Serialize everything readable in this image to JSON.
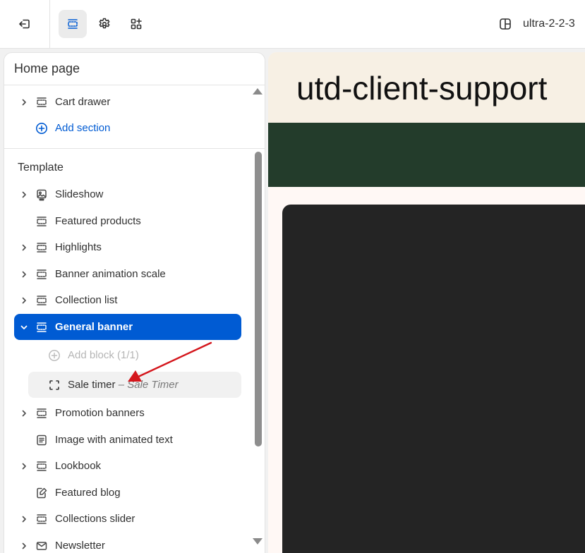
{
  "theme_name": "ultra-2-2-3",
  "sidebar": {
    "title": "Home page",
    "header_items": [
      {
        "label": "Cart drawer"
      }
    ],
    "add_section_label": "Add section",
    "template_label": "Template",
    "items": [
      {
        "label": "Slideshow"
      },
      {
        "label": "Featured products"
      },
      {
        "label": "Highlights"
      },
      {
        "label": "Banner animation scale"
      },
      {
        "label": "Collection list"
      },
      {
        "label": "General banner"
      },
      {
        "label": "Promotion banners"
      },
      {
        "label": "Image with animated text"
      },
      {
        "label": "Lookbook"
      },
      {
        "label": "Featured blog"
      },
      {
        "label": "Collections slider"
      },
      {
        "label": "Newsletter"
      }
    ],
    "children": {
      "add_block_label": "Add block (1/1)",
      "block_label": "Sale timer",
      "block_separator": " – ",
      "block_name": "Sale Timer"
    }
  },
  "preview": {
    "store_title": "utd-client-support"
  },
  "colors": {
    "selected": "#005bd3",
    "header_bg": "#f7f0e4",
    "band": "#233c2b",
    "dark_block": "#242424",
    "arrow": "#d4161c"
  }
}
